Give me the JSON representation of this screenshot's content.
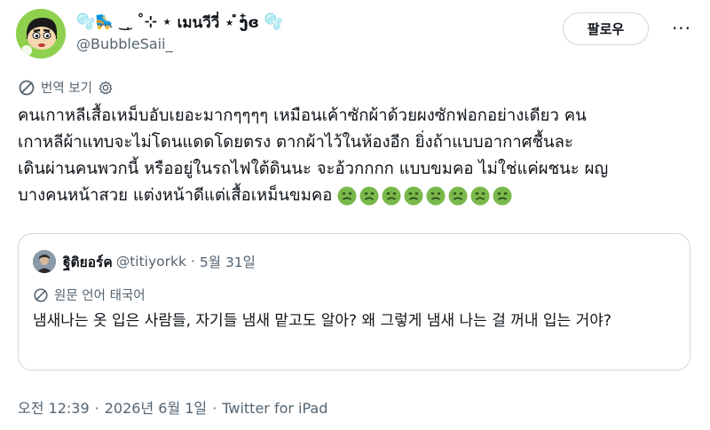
{
  "author": {
    "display_name": "🫧🛼 ‿̩͙ ⊹ ⋆  เมนวีวี่ ⋆ ⁽ɞ⁾ ʬɞ ⋆ 🫧",
    "name_prefix": "🫧🛼 ‿̩ ˚⊹ ⋆",
    "name_main": "เมนวีวี่ ⋆ ໍງ໋ɞ",
    "name_suffix": "🫧",
    "handle": "@BubbleSaii_"
  },
  "follow_label": "팔로우",
  "more_label": "···",
  "translate_label": "번역 보기",
  "tweet_lines": [
    "คนเกาหลีเสื้อเหม็บอับเยอะมากๆๆๆๆ เหมือนเค้าซักผ้าด้วยผงซักฟอกอย่างเดียว คน",
    "เกาหลีผ้าแทบจะไม่โดนแดดโดยตรง ตากผ้าไว้ในห้องอีก  ยิ่งถ้าแบบอากาศชื้นละ",
    "เดินผ่านคนพวกนี้ หรืออยู่ในรถไฟใต้ดินนะ จะอ้วกกกก แบบขมคอ ไม่ใช่แค่ผชนะ ผญ",
    "บางคนหน้าสวย แต่งหน้าดีแต่เสื้อเหม็นขมคอ"
  ],
  "emoji_count_label": "🤢🤢🤢🤢🤢🤢🤢🤢",
  "quote": {
    "name": "ฐิติยอร์ค",
    "handle": "@titiyorkk",
    "separator": "·",
    "date": "5월 31일",
    "translate_label": "원문 언어 태국어",
    "text": "냄새나는 옷 입은 사람들, 자기들 냄새 맡고도 알아? 왜 그렇게 냄새 나는 걸 꺼내 입는 거야?"
  },
  "footer": {
    "time": "오전 12:39",
    "date": "2026년 6월 1일",
    "source": "Twitter for iPad",
    "separator": "·"
  },
  "colors": {
    "text": "#0f1419",
    "secondary": "#536471",
    "border": "#cfd9de",
    "emoji_green": "#79b84a"
  }
}
